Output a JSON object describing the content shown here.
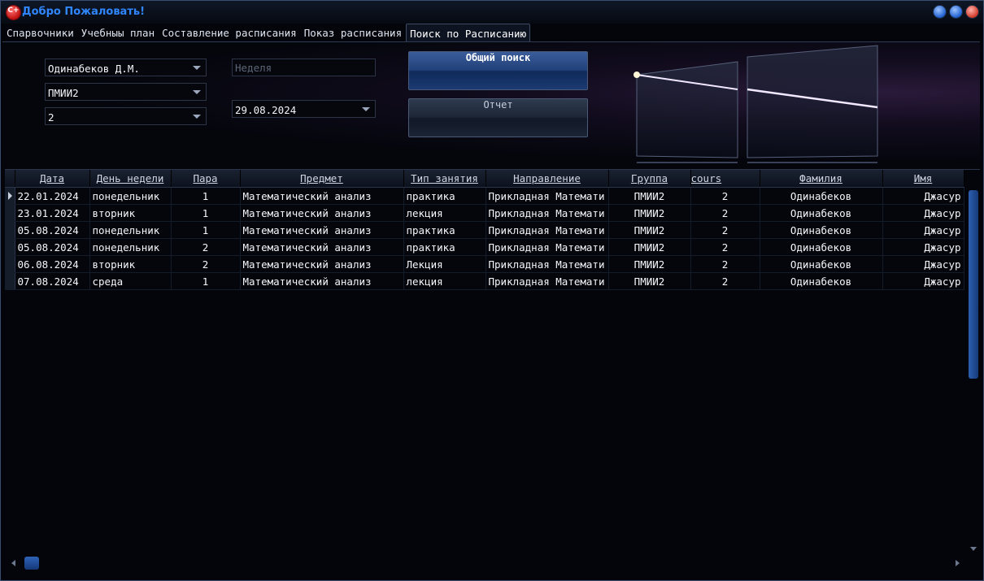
{
  "window": {
    "title": "Добро Пожаловать!",
    "icon": "app-logo-icon"
  },
  "tabs": [
    {
      "label": "Спарвочники"
    },
    {
      "label": "Учебныы план"
    },
    {
      "label": "Составление расписания"
    },
    {
      "label": "Показ расписания"
    },
    {
      "label": "Поиск по Расписанию",
      "active": true
    }
  ],
  "filters": {
    "teacher": "Одинабеков Д.М.",
    "group": "ПМИИ2",
    "course": "2",
    "week_placeholder": "Неделя",
    "date": "29.08.2024"
  },
  "actions": {
    "search_label": "Общий поиск",
    "report_label": "Отчет"
  },
  "grid": {
    "columns": [
      "Дата",
      "День недели",
      "Пара",
      "Предмет",
      "Тип занятия",
      "Направление",
      "Группа",
      "cours",
      "Фамилия",
      "Имя"
    ],
    "rows": [
      [
        "22.01.2024",
        "понедельник",
        "1",
        "Математический анализ",
        "практика",
        "Прикладная Математи",
        "ПМИИ2",
        "2",
        "Одинабеков",
        "Джасур"
      ],
      [
        "23.01.2024",
        "вторник",
        "1",
        "Математический анализ",
        "лекция",
        "Прикладная Математи",
        "ПМИИ2",
        "2",
        "Одинабеков",
        "Джасур"
      ],
      [
        "05.08.2024",
        "понедельник",
        "1",
        "Математический анализ",
        "практика",
        "Прикладная Математи",
        "ПМИИ2",
        "2",
        "Одинабеков",
        "Джасур"
      ],
      [
        "05.08.2024",
        "понедельник",
        "2",
        "Математический анализ",
        "практика",
        "Прикладная Математи",
        "ПМИИ2",
        "2",
        "Одинабеков",
        "Джасур"
      ],
      [
        "06.08.2024",
        "вторник",
        "2",
        "Математический анализ",
        "Лекция",
        "Прикладная Математи",
        "ПМИИ2",
        "2",
        "Одинабеков",
        "Джасур"
      ],
      [
        "07.08.2024",
        "среда",
        "1",
        "Математический анализ",
        "лекция",
        "Прикладная Математи",
        "ПМИИ2",
        "2",
        "Одинабеков",
        "Джасур"
      ]
    ]
  },
  "colors": {
    "accent": "#2f86ff",
    "background": "#03050b",
    "primary_button": "#21417a"
  }
}
